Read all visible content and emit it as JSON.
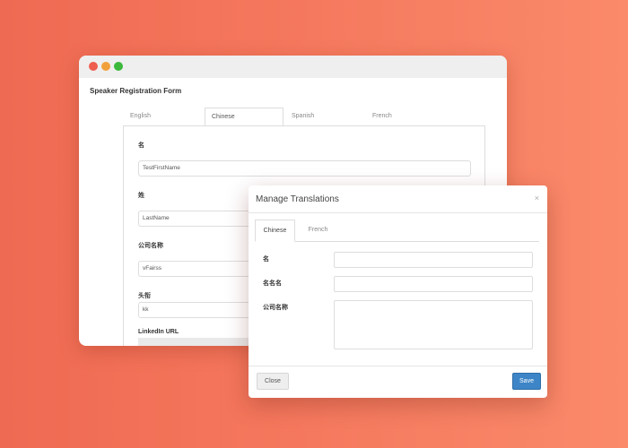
{
  "form": {
    "title": "Speaker Registration Form",
    "tabs": [
      "English",
      "Chinese",
      "Spanish",
      "French"
    ],
    "fields": [
      {
        "label": "名",
        "value": "TestFirstName"
      },
      {
        "label": "姓",
        "value": "LastName"
      },
      {
        "label": "公司名称",
        "value": "vFairss"
      },
      {
        "label": "头衔",
        "value": "kk"
      },
      {
        "label": "LinkedIn URL",
        "value": ""
      }
    ]
  },
  "modal": {
    "title": "Manage Translations",
    "close_glyph": "×",
    "tabs": [
      "Chinese",
      "French"
    ],
    "fields": [
      {
        "label": "名"
      },
      {
        "label": "名名名"
      },
      {
        "label": "公司名称"
      }
    ],
    "close_label": "Close",
    "save_label": "Save"
  },
  "colors": {
    "background_left": "#ef6a52",
    "background_right": "#fa8a6a",
    "save_button": "#3d85c6"
  }
}
